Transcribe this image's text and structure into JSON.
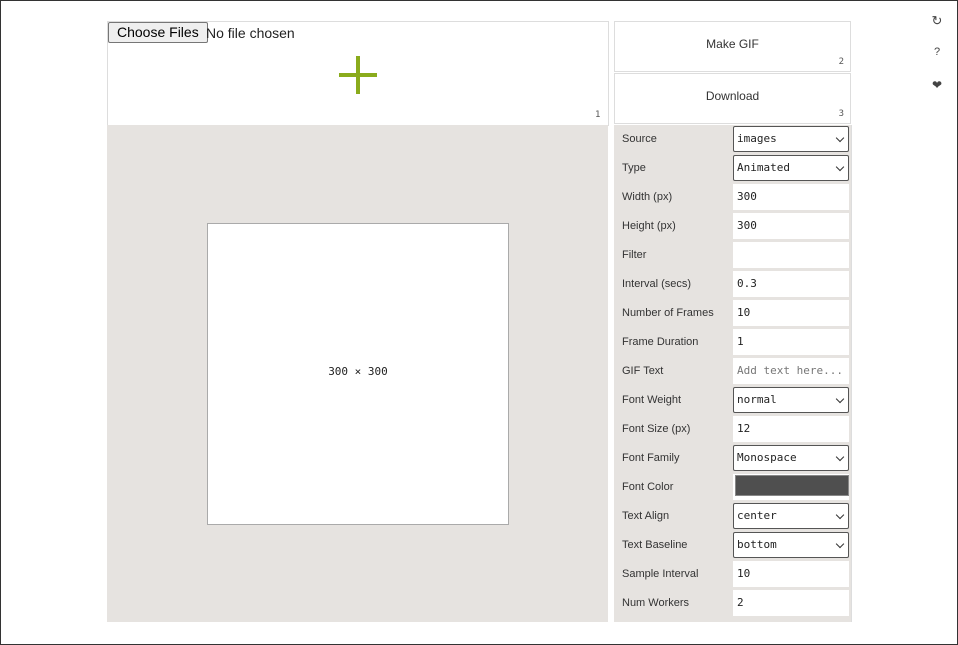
{
  "upload": {
    "choose_label": "Choose Files",
    "status": "No file chosen",
    "badge": "1"
  },
  "preview": {
    "canvas_label": "300 × 300"
  },
  "actions": {
    "make_gif": "Make GIF",
    "make_gif_badge": "2",
    "download": "Download",
    "download_badge": "3"
  },
  "settings": [
    {
      "label": "Source",
      "kind": "select",
      "value": "images"
    },
    {
      "label": "Type",
      "kind": "select",
      "value": "Animated"
    },
    {
      "label": "Width (px)",
      "kind": "input",
      "value": "300"
    },
    {
      "label": "Height (px)",
      "kind": "input",
      "value": "300"
    },
    {
      "label": "Filter",
      "kind": "input",
      "value": ""
    },
    {
      "label": "Interval (secs)",
      "kind": "input",
      "value": "0.3"
    },
    {
      "label": "Number of Frames",
      "kind": "input",
      "value": "10"
    },
    {
      "label": "Frame Duration",
      "kind": "input",
      "value": "1"
    },
    {
      "label": "GIF Text",
      "kind": "input",
      "value": "",
      "placeholder": "Add text here..."
    },
    {
      "label": "Font Weight",
      "kind": "select",
      "value": "normal"
    },
    {
      "label": "Font Size (px)",
      "kind": "input",
      "value": "12"
    },
    {
      "label": "Font Family",
      "kind": "select",
      "value": "Monospace"
    },
    {
      "label": "Font Color",
      "kind": "color",
      "value": "#4f4f4f"
    },
    {
      "label": "Text Align",
      "kind": "select",
      "value": "center"
    },
    {
      "label": "Text Baseline",
      "kind": "select",
      "value": "bottom"
    },
    {
      "label": "Sample Interval",
      "kind": "input",
      "value": "10"
    },
    {
      "label": "Num Workers",
      "kind": "input",
      "value": "2"
    }
  ],
  "side_icons": {
    "refresh": "↻",
    "help": "?",
    "heart": "❤"
  },
  "colors": {
    "accent": "#8aab1c",
    "panel_bg": "#e6e3e0"
  }
}
